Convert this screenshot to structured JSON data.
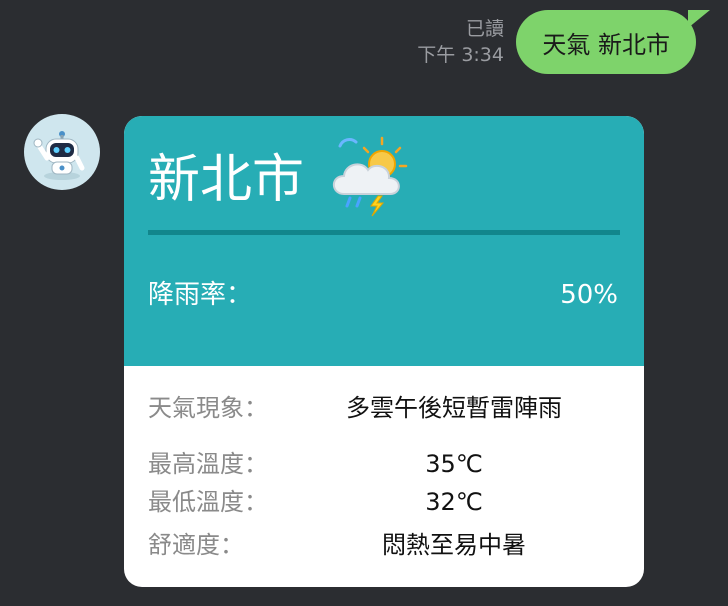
{
  "chat": {
    "read_status": "已讀",
    "time": "下午 3:34",
    "outgoing_message": "天氣 新北市"
  },
  "bot": {
    "avatar_icon": "robot-icon"
  },
  "card": {
    "city": "新北市",
    "weather_icon": "cloud-sun-thunder-icon",
    "rain_label": "降雨率：",
    "rain_value": "50%",
    "rows": [
      {
        "label": "天氣現象：",
        "value": "多雲午後短暫雷陣雨"
      },
      {
        "label": "最高溫度：",
        "value": "35℃"
      },
      {
        "label": "最低溫度：",
        "value": "32℃"
      },
      {
        "label": "舒適度：",
        "value": "悶熱至易中暑"
      }
    ]
  },
  "colors": {
    "background": "#2b2d31",
    "outgoing_bubble": "#7ed36b",
    "card_header": "#27adb5",
    "divider": "#11868c"
  }
}
